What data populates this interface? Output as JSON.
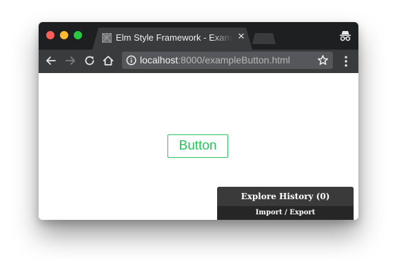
{
  "browser": {
    "tab": {
      "title": "Elm Style Framework - Example Button",
      "close_glyph": "✕"
    },
    "icons": {
      "favicon": "elm-tangram-icon",
      "incognito": "incognito-icon",
      "back": "back-arrow-icon",
      "forward": "forward-arrow-icon",
      "reload": "reload-icon",
      "home": "home-icon",
      "site_info": "info-icon",
      "bookmark": "star-icon",
      "menu": "kebab-menu-icon"
    },
    "address": {
      "host": "localhost",
      "rest": ":8000/exampleButton.html"
    },
    "colors": {
      "close": "#fc5f57",
      "minimize": "#fdbc2e",
      "maximize": "#28c840",
      "chrome_dark": "#1e1f21",
      "toolbar": "#3a3b3d"
    }
  },
  "page": {
    "button_label": "Button",
    "accent_color": "#23c55a"
  },
  "debugger": {
    "title": "Explore History (0)",
    "subtitle": "Import / Export"
  }
}
